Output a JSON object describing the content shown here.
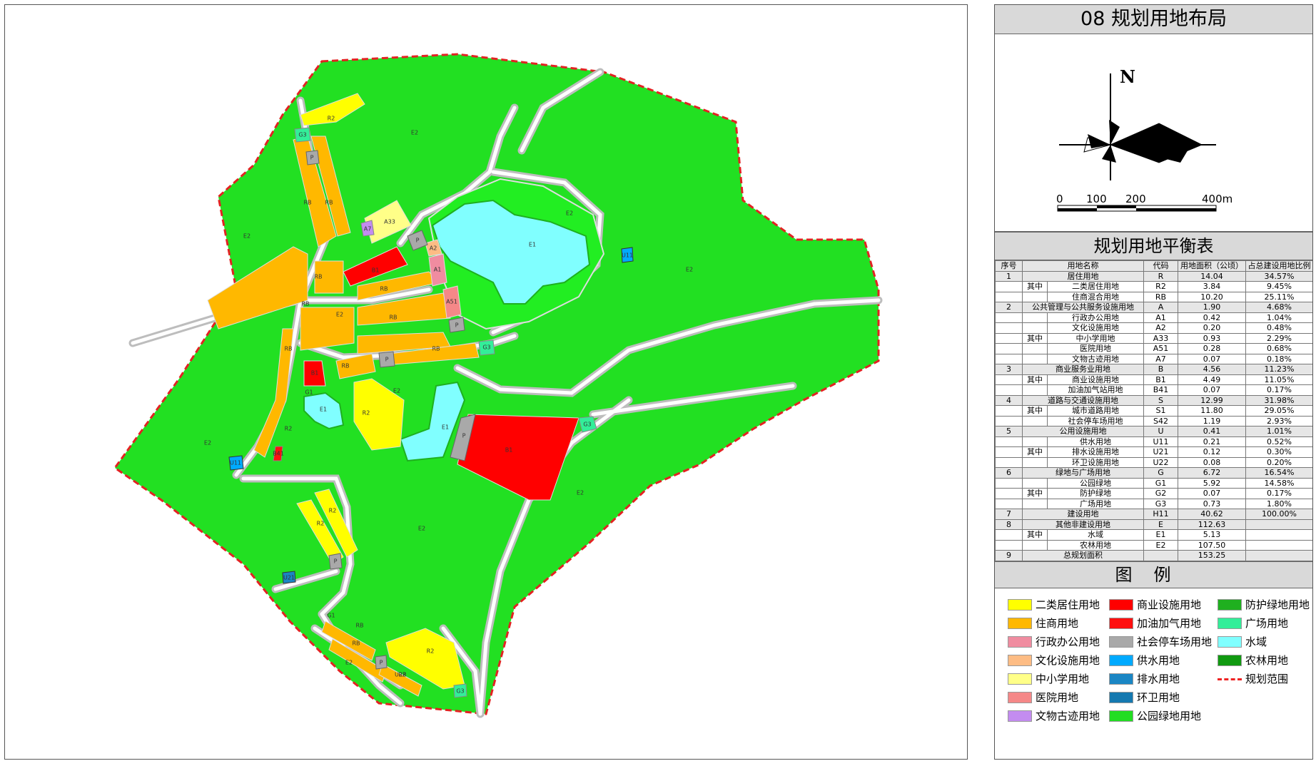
{
  "zone_labels": {
    "e2": "E2",
    "e1": "E1",
    "r2": "R2",
    "rb": "RB",
    "p": "P",
    "g3": "G3",
    "g1": "G1",
    "a1": "A1",
    "a2": "A2",
    "a33": "A33",
    "a51": "A51",
    "a7": "A7",
    "b1": "B1",
    "b41": "B41",
    "u11": "U11",
    "u21": "U21",
    "u22": "U22"
  },
  "panel": {
    "title": "08  规划用地布局",
    "north_label": "N",
    "scale_labels": [
      "0",
      "100",
      "200",
      "400m"
    ],
    "table_title": "规划用地平衡表",
    "table_headers": [
      "序号",
      "用地名称",
      "代码",
      "用地面积（公顷）",
      "占总建设用地比例"
    ],
    "rows": [
      {
        "no": "1",
        "qz": "",
        "name": "居住用地",
        "code": "R",
        "area": "14.04",
        "pct": "34.57%",
        "cat": true
      },
      {
        "no": "",
        "qz": "其中",
        "name": "二类居住用地",
        "code": "R2",
        "area": "3.84",
        "pct": "9.45%"
      },
      {
        "no": "",
        "qz": "",
        "name": "住商混合用地",
        "code": "RB",
        "area": "10.20",
        "pct": "25.11%"
      },
      {
        "no": "2",
        "qz": "",
        "name": "公共管理与公共服务设施用地",
        "code": "A",
        "area": "1.90",
        "pct": "4.68%",
        "cat": true
      },
      {
        "no": "",
        "qz": "",
        "name": "行政办公用地",
        "code": "A1",
        "area": "0.42",
        "pct": "1.04%"
      },
      {
        "no": "",
        "qz": "",
        "name": "文化设施用地",
        "code": "A2",
        "area": "0.20",
        "pct": "0.48%"
      },
      {
        "no": "",
        "qz": "其中",
        "name": "中小学用地",
        "code": "A33",
        "area": "0.93",
        "pct": "2.29%"
      },
      {
        "no": "",
        "qz": "",
        "name": "医院用地",
        "code": "A51",
        "area": "0.28",
        "pct": "0.68%"
      },
      {
        "no": "",
        "qz": "",
        "name": "文物古迹用地",
        "code": "A7",
        "area": "0.07",
        "pct": "0.18%"
      },
      {
        "no": "3",
        "qz": "",
        "name": "商业服务业用地",
        "code": "B",
        "area": "4.56",
        "pct": "11.23%",
        "cat": true
      },
      {
        "no": "",
        "qz": "其中",
        "name": "商业设施用地",
        "code": "B1",
        "area": "4.49",
        "pct": "11.05%"
      },
      {
        "no": "",
        "qz": "",
        "name": "加油加气站用地",
        "code": "B41",
        "area": "0.07",
        "pct": "0.17%"
      },
      {
        "no": "4",
        "qz": "",
        "name": "道路与交通设施用地",
        "code": "S",
        "area": "12.99",
        "pct": "31.98%",
        "cat": true
      },
      {
        "no": "",
        "qz": "其中",
        "name": "城市道路用地",
        "code": "S1",
        "area": "11.80",
        "pct": "29.05%"
      },
      {
        "no": "",
        "qz": "",
        "name": "社会停车场用地",
        "code": "S42",
        "area": "1.19",
        "pct": "2.93%"
      },
      {
        "no": "5",
        "qz": "",
        "name": "公用设施用地",
        "code": "U",
        "area": "0.41",
        "pct": "1.01%",
        "cat": true
      },
      {
        "no": "",
        "qz": "",
        "name": "供水用地",
        "code": "U11",
        "area": "0.21",
        "pct": "0.52%"
      },
      {
        "no": "",
        "qz": "其中",
        "name": "排水设施用地",
        "code": "U21",
        "area": "0.12",
        "pct": "0.30%"
      },
      {
        "no": "",
        "qz": "",
        "name": "环卫设施用地",
        "code": "U22",
        "area": "0.08",
        "pct": "0.20%"
      },
      {
        "no": "6",
        "qz": "",
        "name": "绿地与广场用地",
        "code": "G",
        "area": "6.72",
        "pct": "16.54%",
        "cat": true
      },
      {
        "no": "",
        "qz": "",
        "name": "公园绿地",
        "code": "G1",
        "area": "5.92",
        "pct": "14.58%"
      },
      {
        "no": "",
        "qz": "其中",
        "name": "防护绿地",
        "code": "G2",
        "area": "0.07",
        "pct": "0.17%"
      },
      {
        "no": "",
        "qz": "",
        "name": "广场用地",
        "code": "G3",
        "area": "0.73",
        "pct": "1.80%"
      },
      {
        "no": "7",
        "qz": "",
        "name": "建设用地",
        "code": "H11",
        "area": "40.62",
        "pct": "100.00%",
        "cat": true
      },
      {
        "no": "8",
        "qz": "",
        "name": "其他非建设用地",
        "code": "E",
        "area": "112.63",
        "pct": "",
        "cat": true
      },
      {
        "no": "",
        "qz": "其中",
        "name": "水域",
        "code": "E1",
        "area": "5.13",
        "pct": ""
      },
      {
        "no": "",
        "qz": "",
        "name": "农林用地",
        "code": "E2",
        "area": "107.50",
        "pct": ""
      },
      {
        "no": "9",
        "qz": "",
        "name": "总规划面积",
        "code": "",
        "area": "153.25",
        "pct": "",
        "cat": true
      }
    ],
    "legend_title": "图例",
    "legend": [
      {
        "label": "二类居住用地",
        "color": "#ffff00"
      },
      {
        "label": "商业设施用地",
        "color": "#ff0000"
      },
      {
        "label": "防护绿地用地",
        "color": "#1fb01f"
      },
      {
        "label": "住商用地",
        "color": "#ffb800"
      },
      {
        "label": "加油加气用地",
        "color": "#ff1010"
      },
      {
        "label": "广场用地",
        "color": "#33ee99"
      },
      {
        "label": "行政办公用地",
        "color": "#f08ca0"
      },
      {
        "label": "社会停车场用地",
        "color": "#a9a9a9"
      },
      {
        "label": "水域",
        "color": "#80ffff"
      },
      {
        "label": "文化设施用地",
        "color": "#fdbc84"
      },
      {
        "label": "供水用地",
        "color": "#00aaff"
      },
      {
        "label": "农林用地",
        "color": "#119911"
      },
      {
        "label": "中小学用地",
        "color": "#ffff88"
      },
      {
        "label": "排水用地",
        "color": "#1a86c4"
      },
      {
        "label": "规划范围",
        "color": "#e22222",
        "line": true
      },
      {
        "label": "医院用地",
        "color": "#f58888"
      },
      {
        "label": "环卫用地",
        "color": "#1579b0"
      },
      {
        "label": "",
        "color": ""
      },
      {
        "label": "文物古迹用地",
        "color": "#c38cf0"
      },
      {
        "label": "公园绿地用地",
        "color": "#22dd22"
      }
    ]
  }
}
